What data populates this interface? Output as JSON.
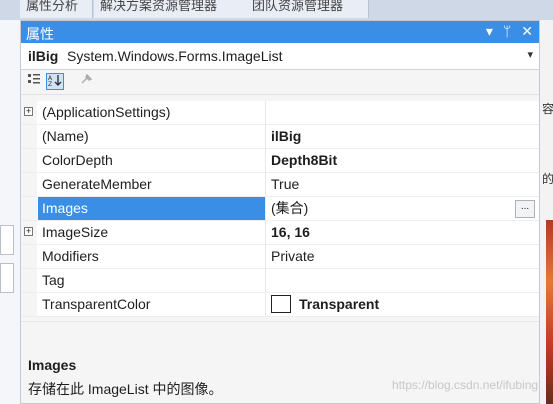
{
  "background": {
    "tabs": [
      "属性分析",
      "解决方案资源管理器",
      "团队资源管理器"
    ],
    "right_chars": [
      "容",
      "的"
    ]
  },
  "panel": {
    "title": "属性",
    "title_icons": [
      "▾",
      "ᛘ",
      "✕"
    ],
    "object": {
      "name": "ilBig",
      "type": "System.Windows.Forms.ImageList"
    },
    "properties": [
      {
        "name": "(ApplicationSettings)",
        "value": "",
        "expandable": true,
        "bold": false
      },
      {
        "name": "(Name)",
        "value": "ilBig",
        "expandable": false,
        "bold": true
      },
      {
        "name": "ColorDepth",
        "value": "Depth8Bit",
        "expandable": false,
        "bold": true
      },
      {
        "name": "GenerateMember",
        "value": "True",
        "expandable": false,
        "bold": false
      },
      {
        "name": "Images",
        "value": "(集合)",
        "expandable": false,
        "bold": false,
        "selected": true,
        "has_ellipsis": true,
        "ellipsis_label": "..."
      },
      {
        "name": "ImageSize",
        "value": "16, 16",
        "expandable": true,
        "bold": true
      },
      {
        "name": "Modifiers",
        "value": "Private",
        "expandable": false,
        "bold": false
      },
      {
        "name": "Tag",
        "value": "",
        "expandable": false,
        "bold": false
      },
      {
        "name": "TransparentColor",
        "value": "Transparent",
        "expandable": false,
        "bold": true,
        "swatch": "#ffffff"
      }
    ],
    "description": {
      "title": "Images",
      "text": "存储在此 ImageList 中的图像。"
    }
  },
  "watermark": "https://blog.csdn.net/ifubing",
  "colors": {
    "accent": "#3a8ee6"
  }
}
